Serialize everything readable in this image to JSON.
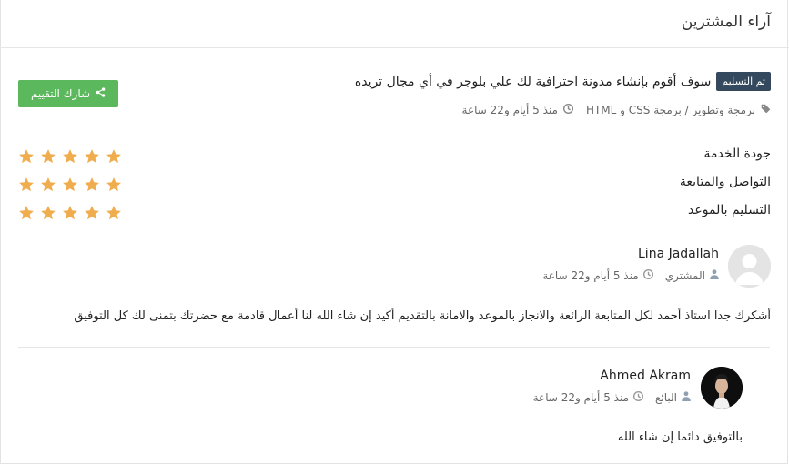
{
  "header": {
    "title": "آراء المشترين"
  },
  "service": {
    "badge": "تم التسليم",
    "title": "سوف أقوم بإنشاء مدونة احترافية لك علي بلوجر في أي مجال تريده",
    "category": "برمجة وتطوير / برمجة CSS و HTML",
    "time": "منذ 5 أيام و22 ساعة",
    "share_label": "شارك التقييم"
  },
  "ratings": [
    {
      "label": "جودة الخدمة",
      "stars": 5
    },
    {
      "label": "التواصل والمتابعة",
      "stars": 5
    },
    {
      "label": "التسليم بالموعد",
      "stars": 5
    }
  ],
  "comments": [
    {
      "name": "Lina Jadallah",
      "role": "المشتري",
      "time": "منذ 5 أيام و22 ساعة",
      "text": "أشكرك جدا استاذ أحمد لكل المتابعة الرائعة والانجاز بالموعد والامانة بالتقديم أكيد إن شاء الله لنا أعمال قادمة مع حضرتك بتمنى لك كل التوفيق"
    },
    {
      "name": "Ahmed Akram",
      "role": "البائع",
      "time": "منذ 5 أيام و22 ساعة",
      "text": "بالتوفيق دائما إن شاء الله"
    }
  ],
  "colors": {
    "star": "#f0ad4e",
    "share": "#5cb85c",
    "badge": "#34495e"
  },
  "icons": {
    "share": "share-icon",
    "tag": "tag-icon",
    "clock": "clock-icon",
    "user": "user-icon"
  }
}
